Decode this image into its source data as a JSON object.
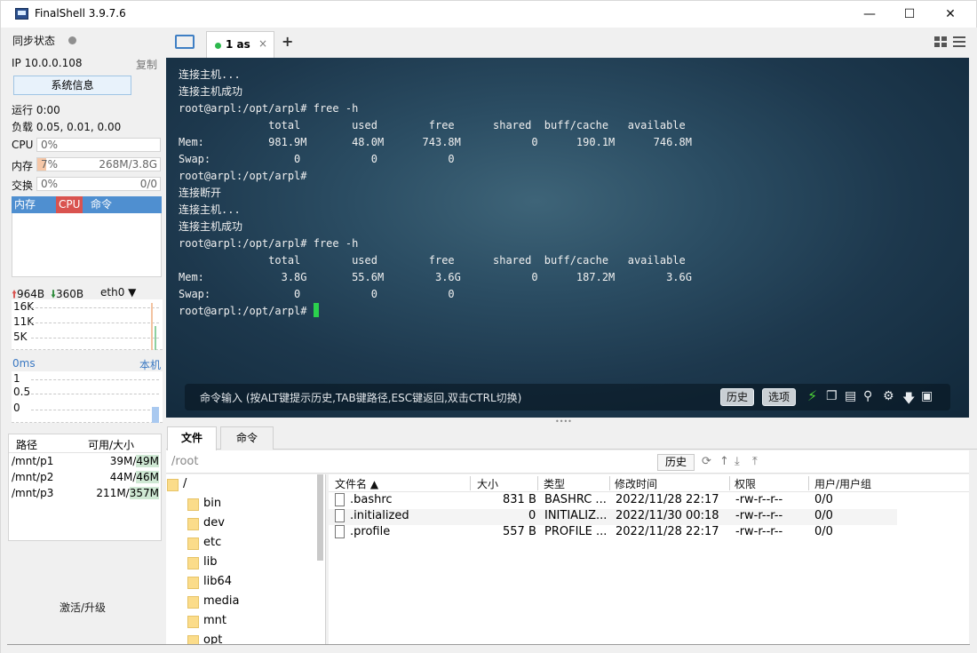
{
  "window": {
    "title": "FinalShell 3.9.7.6"
  },
  "sidebar": {
    "sync_label": "同步状态",
    "ip_label": "IP 10.0.0.108",
    "copy_label": "复制",
    "sysinfo_button": "系统信息",
    "uptime": "运行 0:00",
    "load": "负载 0.05, 0.01, 0.00",
    "cpu": {
      "label": "CPU",
      "percent": "0%",
      "fill": 0
    },
    "mem": {
      "label": "内存",
      "percent": "7%",
      "amount": "268M/3.8G",
      "fill": 0.07
    },
    "swap": {
      "label": "交换",
      "percent": "0%",
      "amount": "0/0",
      "fill": 0
    },
    "proc_tabs": [
      "内存",
      "CPU",
      "命令"
    ],
    "net": {
      "up": "964B",
      "down": "360B",
      "iface": "eth0",
      "yticks": [
        "16K",
        "11K",
        "5K"
      ]
    },
    "latency": {
      "label": "0ms",
      "host": "本机",
      "yticks": [
        "1",
        "0.5",
        "0"
      ]
    },
    "disk": {
      "headers": [
        "路径",
        "可用/大小"
      ],
      "rows": [
        {
          "path": "/mnt/p1",
          "avail": "39M/",
          "size": "49M"
        },
        {
          "path": "/mnt/p2",
          "avail": "44M/",
          "size": "46M"
        },
        {
          "path": "/mnt/p3",
          "avail": "211M/",
          "size": "357M"
        }
      ]
    },
    "activate": "激活/升级"
  },
  "tabs": {
    "active_label": "1 as",
    "close": "×",
    "add": "+"
  },
  "terminal": {
    "lines": [
      "连接主机...",
      "连接主机成功",
      "root@arpl:/opt/arpl# free -h",
      "              total        used        free      shared  buff/cache   available",
      "Mem:          981.9M       48.0M      743.8M           0      190.1M      746.8M",
      "Swap:             0           0           0",
      "root@arpl:/opt/arpl#",
      "连接断开",
      "连接主机...",
      "连接主机成功",
      "root@arpl:/opt/arpl# free -h",
      "              total        used        free      shared  buff/cache   available",
      "Mem:            3.8G       55.6M        3.6G           0      187.2M        3.6G",
      "Swap:             0           0           0"
    ],
    "prompt": "root@arpl:/opt/arpl# ",
    "cmd_hint": "命令输入 (按ALT键提示历史,TAB键路径,ESC键返回,双击CTRL切换)",
    "history_btn": "历史",
    "options_btn": "选项"
  },
  "files": {
    "tabs": [
      "文件",
      "命令"
    ],
    "path": "/root",
    "history_btn": "历史",
    "tree": [
      "/",
      "bin",
      "dev",
      "etc",
      "lib",
      "lib64",
      "media",
      "mnt",
      "opt"
    ],
    "headers": [
      "文件名",
      "大小",
      "类型",
      "修改时间",
      "权限",
      "用户/用户组"
    ],
    "rows": [
      {
        "name": ".bashrc",
        "size": "831 B",
        "type": "BASHRC ...",
        "mtime": "2022/11/28 22:17",
        "perm": "-rw-r--r--",
        "owner": "0/0"
      },
      {
        "name": ".initialized",
        "size": "0",
        "type": "INITIALIZ...",
        "mtime": "2022/11/30 00:18",
        "perm": "-rw-r--r--",
        "owner": "0/0"
      },
      {
        "name": ".profile",
        "size": "557 B",
        "type": "PROFILE ...",
        "mtime": "2022/11/28 22:17",
        "perm": "-rw-r--r--",
        "owner": "0/0"
      }
    ]
  },
  "colors": {
    "accent": "#4f8fd0",
    "cursor": "#2bd14d",
    "cpu_tab": "#d9534f",
    "lightning": "#4cd137"
  }
}
